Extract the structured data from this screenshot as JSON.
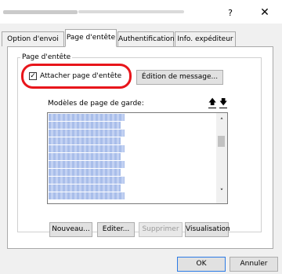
{
  "window": {
    "help_label": "?",
    "close_label": "✕"
  },
  "tabs": [
    {
      "label": "Option d'envoi"
    },
    {
      "label": "Page d'entête"
    },
    {
      "label": "Authentification"
    },
    {
      "label": "Info. expéditeur"
    }
  ],
  "group": {
    "legend": "Page d'entête",
    "attach_checkbox": {
      "label": "Attacher page d'entête",
      "checked": true,
      "mark": "✓"
    },
    "edit_message_button": "Édition de message...",
    "templates_label": "Modèles de page de garde:",
    "move_up_icon": "🡅",
    "move_down_icon": "🡇",
    "scroll_up": "˄",
    "scroll_down": "˅",
    "buttons": {
      "new": "Nouveau...",
      "edit": "Editer...",
      "delete": "Supprimer",
      "preview": "Visualisation"
    }
  },
  "footer": {
    "ok": "OK",
    "cancel": "Annuler"
  },
  "colors": {
    "highlight_ring": "#e8151b",
    "default_button_border": "#2c7be5"
  }
}
